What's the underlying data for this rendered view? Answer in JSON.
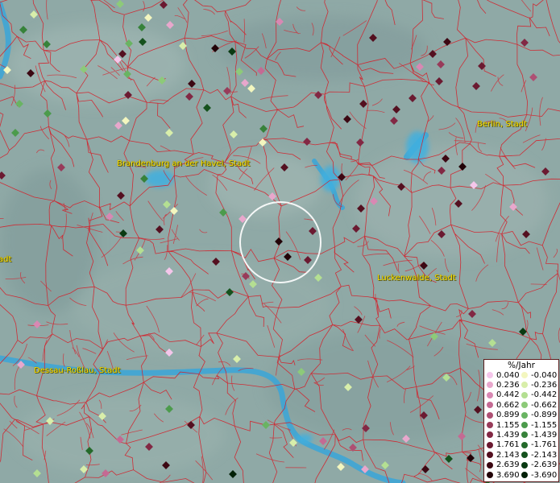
{
  "map": {
    "labels": [
      {
        "id": "berlin",
        "text": "Berlin, Stadt"
      },
      {
        "id": "brandenburg",
        "text": "Brandenburg an der Havel, Stadt"
      },
      {
        "id": "luckenwalde",
        "text": "Luckenwalde, Stadt"
      },
      {
        "id": "dessau",
        "text": "Dessau-Roßlau, Stadt"
      },
      {
        "id": "left-edge",
        "text": "adt"
      }
    ]
  },
  "legend": {
    "title": "%/Jahr",
    "positive": [
      {
        "value": "0.040",
        "color": "#f4c6ea"
      },
      {
        "value": "0.236",
        "color": "#e8a7cc"
      },
      {
        "value": "0.442",
        "color": "#d888b3"
      },
      {
        "value": "0.662",
        "color": "#c46a93"
      },
      {
        "value": "0.899",
        "color": "#ae5073"
      },
      {
        "value": "1.155",
        "color": "#983b5a"
      },
      {
        "value": "1.439",
        "color": "#822844"
      },
      {
        "value": "1.761",
        "color": "#6b1a31"
      },
      {
        "value": "2.143",
        "color": "#541020"
      },
      {
        "value": "2.639",
        "color": "#3c0813"
      },
      {
        "value": "3.690",
        "color": "#220308"
      }
    ],
    "negative": [
      {
        "value": "-0.040",
        "color": "#f3f6bf"
      },
      {
        "value": "-0.236",
        "color": "#d8eeaa"
      },
      {
        "value": "-0.442",
        "color": "#b4df92"
      },
      {
        "value": "-0.662",
        "color": "#8dca79"
      },
      {
        "value": "-0.899",
        "color": "#69b462"
      },
      {
        "value": "-1.155",
        "color": "#4c9b4c"
      },
      {
        "value": "-1.439",
        "color": "#37823a"
      },
      {
        "value": "-1.761",
        "color": "#246a2a"
      },
      {
        "value": "-2.143",
        "color": "#15521d"
      },
      {
        "value": "-2.639",
        "color": "#0a3a12"
      },
      {
        "value": "-3.690",
        "color": "#032108"
      }
    ]
  },
  "colors": {
    "background": "#8fa9a6",
    "boundaries": "#d4202a",
    "water": "#3aa6d8",
    "highlight_circle": "#ffffff",
    "label": "#ffe400"
  }
}
